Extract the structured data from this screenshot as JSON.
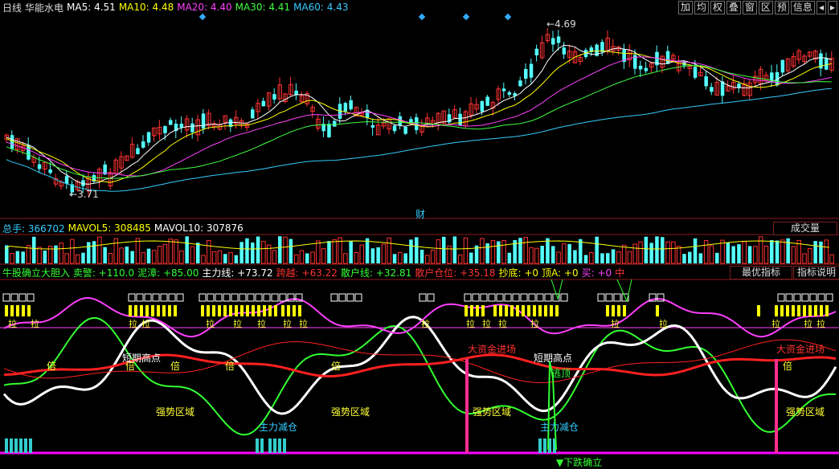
{
  "main": {
    "period": "日线",
    "name": "华能水电",
    "ma": [
      {
        "label": "MA5: ",
        "value": "4.51",
        "color": "#ffffff"
      },
      {
        "label": "MA10: ",
        "value": "4.48",
        "color": "#ffff00"
      },
      {
        "label": "MA20: ",
        "value": "4.40",
        "color": "#ff40ff"
      },
      {
        "label": "MA30: ",
        "value": "4.41",
        "color": "#40ff40"
      },
      {
        "label": "MA60: ",
        "value": "4.43",
        "color": "#33ccff"
      }
    ],
    "high_label": "4.69",
    "low_label": "3.71",
    "cai": "财"
  },
  "toolbar": [
    "加",
    "均",
    "权",
    "叠",
    "窗",
    "区",
    "预",
    "信息",
    "◂",
    "▸"
  ],
  "volume": {
    "items": [
      {
        "label": "总手: ",
        "value": "366702",
        "color": "#33ccff"
      },
      {
        "label": "MAVOL5: ",
        "value": "308485",
        "color": "#ffff00"
      },
      {
        "label": "MAVOL10: ",
        "value": "307876",
        "color": "#ffffff"
      }
    ],
    "button": "成交量"
  },
  "indicator": {
    "items": [
      {
        "text": "牛股确立大胆入 卖警: +110.0",
        "color": "#33ff33"
      },
      {
        "text": "泥漳: +85.00",
        "color": "#33ff33"
      },
      {
        "text": "主力线: +73.72",
        "color": "#ffffff"
      },
      {
        "text": "跨越: +63.22",
        "color": "#ff3333"
      },
      {
        "text": "散户线: +32.81",
        "color": "#33ff33"
      },
      {
        "text": "散户仓位: +35.18",
        "color": "#ff3333"
      },
      {
        "text": "抄底: +0",
        "color": "#ffff00"
      },
      {
        "text": "顶A: +0",
        "color": "#ffff00"
      },
      {
        "text": "买: +0",
        "color": "#ff40ff"
      },
      {
        "text": "中",
        "color": "#ff3333"
      }
    ],
    "btn_best": "最优指标",
    "btn_explain": "指标说明",
    "labels": {
      "bei": "倍",
      "la": "拉",
      "short_high": "短期高点",
      "strong_zone": "强势区域",
      "main_reduce": "主力减仓",
      "big_money": "大资金进场",
      "escape_top": "逃顶",
      "down_confirm": "▼下跌确立"
    }
  }
}
